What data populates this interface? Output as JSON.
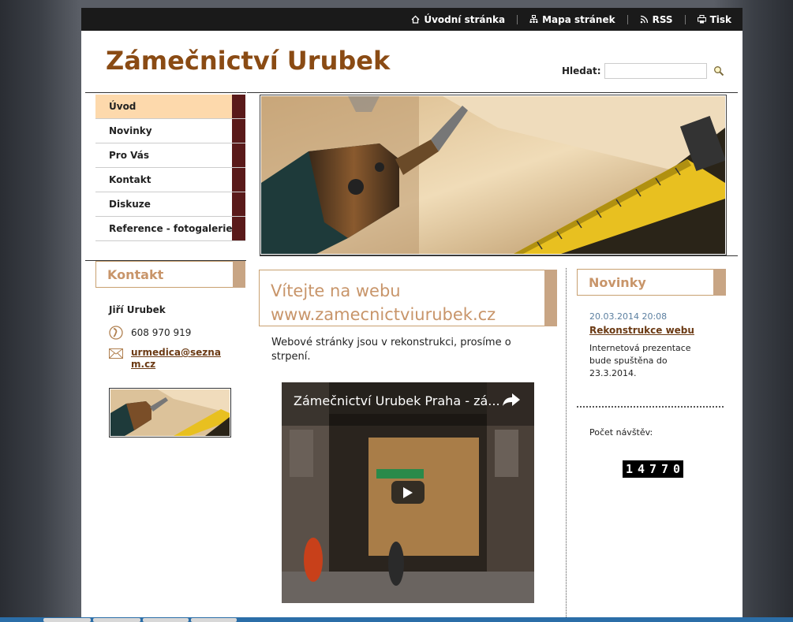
{
  "topnav": [
    {
      "label": "Úvodní stránka",
      "icon": "home-icon"
    },
    {
      "label": "Mapa stránek",
      "icon": "sitemap-icon"
    },
    {
      "label": "RSS",
      "icon": "rss-icon"
    },
    {
      "label": "Tisk",
      "icon": "print-icon"
    }
  ],
  "site": {
    "title": "Zámečnictví Urubek"
  },
  "search": {
    "label": "Hledat:",
    "value": ""
  },
  "nav": [
    {
      "label": "Úvod",
      "active": true
    },
    {
      "label": "Novinky",
      "active": false
    },
    {
      "label": "Pro Vás",
      "active": false
    },
    {
      "label": "Kontakt",
      "active": false
    },
    {
      "label": "Diskuze",
      "active": false
    },
    {
      "label": "Reference - fotogalerie",
      "active": false
    }
  ],
  "contact": {
    "heading": "Kontakt",
    "name": "Jiří Urubek",
    "phone": "608 970 919",
    "email": "urmedica@seznam.cz"
  },
  "main": {
    "heading_line1": "Vítejte na webu",
    "heading_line2": "www.zamecnictviurubek.cz",
    "intro": "Webové stránky jsou v rekonstrukci, prosíme o strpení.",
    "video_title": "Zámečnictví Urubek Praha - zá..."
  },
  "news": {
    "heading": "Novinky",
    "date": "20.03.2014 20:08",
    "title": "Rekonstrukce webu",
    "text": "Internetová prezentace bude spuštěna do 23.3.2014."
  },
  "visits": {
    "label": "Počet návštěv:",
    "count": "14770"
  },
  "colors": {
    "accent": "#8a4b14",
    "tab_dark": "#5a1a1a",
    "tab_light": "#c8a584",
    "active_nav": "#fdd9ac"
  }
}
